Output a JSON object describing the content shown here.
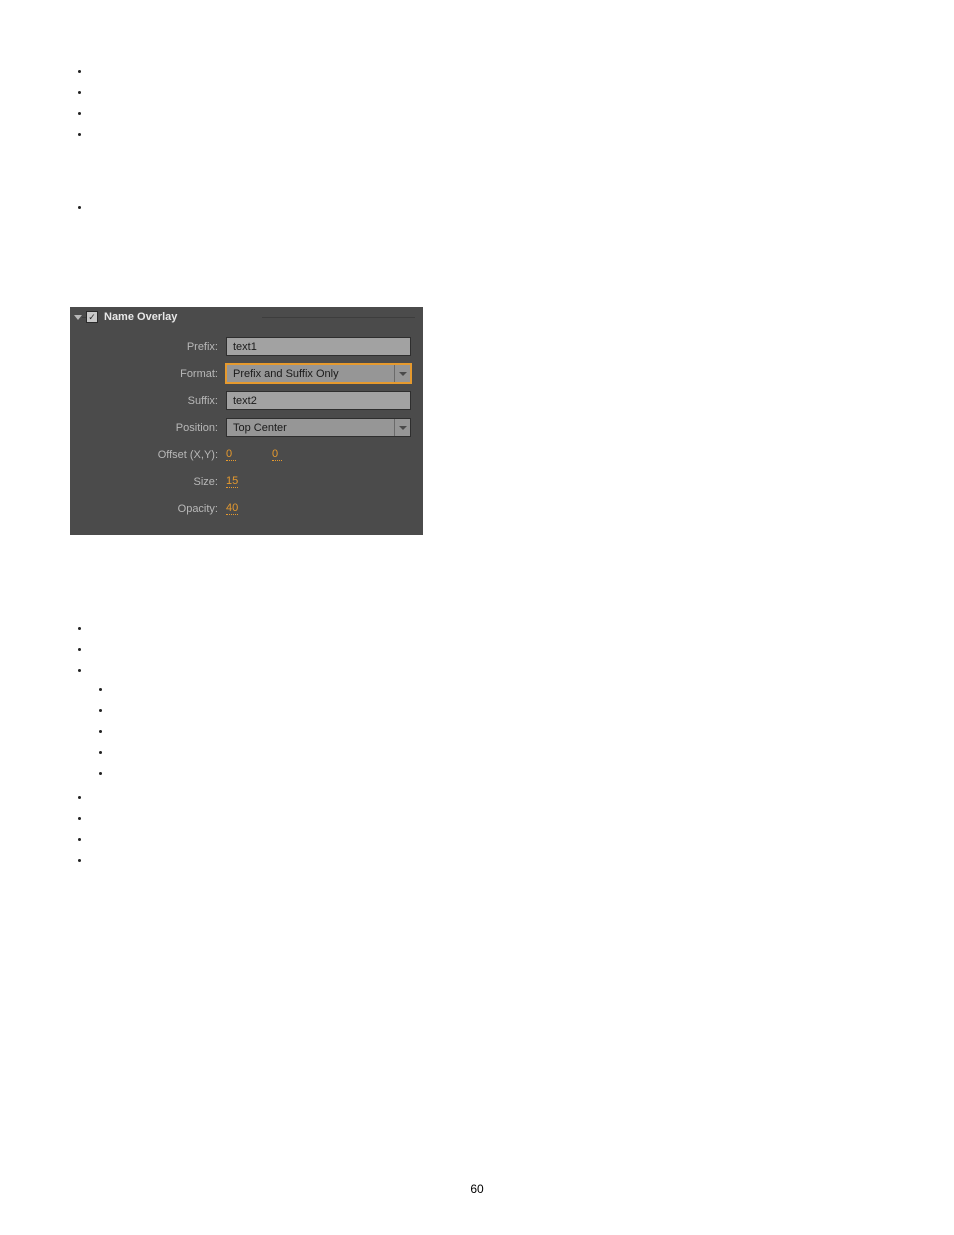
{
  "panel": {
    "title": "Name Overlay",
    "rows": {
      "prefix_label": "Prefix:",
      "prefix_value": "text1",
      "format_label": "Format:",
      "format_value": "Prefix and Suffix Only",
      "suffix_label": "Suffix:",
      "suffix_value": "text2",
      "position_label": "Position:",
      "position_value": "Top Center",
      "offset_label": "Offset (X,Y):",
      "offset_x": "0",
      "offset_y": "0",
      "size_label": "Size:",
      "size_value": "15",
      "opacity_label": "Opacity:",
      "opacity_value": "40"
    }
  },
  "page_number": "60"
}
